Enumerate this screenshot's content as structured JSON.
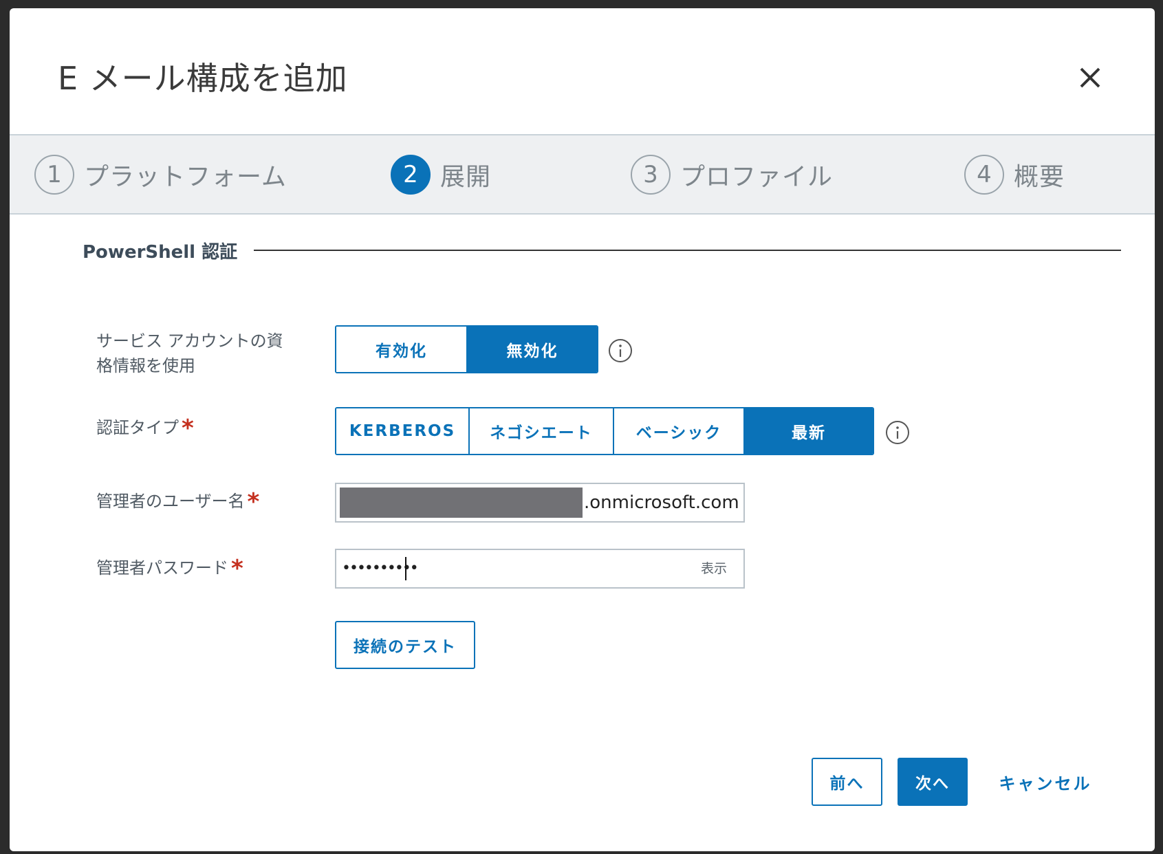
{
  "dialog": {
    "title": "E メール構成を追加",
    "close_icon": "close-icon"
  },
  "steps": [
    {
      "num": "1",
      "label": "プラットフォーム",
      "active": false
    },
    {
      "num": "2",
      "label": "展開",
      "active": true
    },
    {
      "num": "3",
      "label": "プロファイル",
      "active": false
    },
    {
      "num": "4",
      "label": "概要",
      "active": false
    }
  ],
  "section": {
    "title": "PowerShell 認証"
  },
  "service_account": {
    "label_line1": "サービス アカウントの資",
    "label_line2": "格情報を使用",
    "options": [
      "有効化",
      "無効化"
    ],
    "selected": "無効化",
    "info_icon": "info-icon"
  },
  "auth_type": {
    "label": "認証タイプ",
    "required_mark": "*",
    "options": [
      "KERBEROS",
      "ネゴシエート",
      "ベーシック",
      "最新"
    ],
    "selected": "最新",
    "info_icon": "info-icon"
  },
  "admin_username": {
    "label": "管理者のユーザー名",
    "required_mark": "*",
    "value_suffix": ".onmicrosoft.com"
  },
  "admin_password": {
    "label": "管理者パスワード",
    "required_mark": "*",
    "value_masked": "••••••••••",
    "show_label": "表示"
  },
  "test_connection": {
    "label": "接続のテスト"
  },
  "footer": {
    "prev_label": "前へ",
    "next_label": "次へ",
    "cancel_label": "キャンセル"
  },
  "colors": {
    "accent": "#0a72b8",
    "required": "#c4301f",
    "step_bar_bg": "#eef0f2"
  }
}
